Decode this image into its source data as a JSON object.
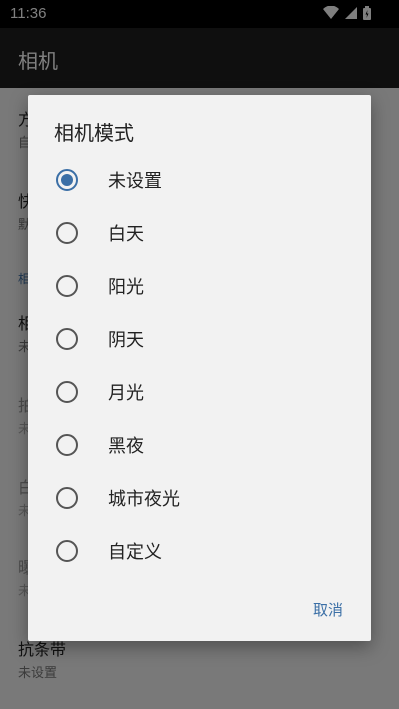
{
  "status_bar": {
    "time": "11:36"
  },
  "app_bar": {
    "title": "相机"
  },
  "background_settings": {
    "rows": [
      {
        "title": "方",
        "summary": "自"
      },
      {
        "title": "快",
        "summary": "默"
      },
      {
        "section": "相"
      },
      {
        "title": "相",
        "summary": "未"
      },
      {
        "title": "拍",
        "summary": "未"
      },
      {
        "title": "白",
        "summary": "未"
      },
      {
        "title": "曝",
        "summary": "未"
      },
      {
        "title": "抗条带",
        "summary": "未设置"
      }
    ]
  },
  "dialog": {
    "title": "相机模式",
    "options": [
      {
        "label": "未设置",
        "selected": true
      },
      {
        "label": "白天",
        "selected": false
      },
      {
        "label": "阳光",
        "selected": false
      },
      {
        "label": "阴天",
        "selected": false
      },
      {
        "label": "月光",
        "selected": false
      },
      {
        "label": "黑夜",
        "selected": false
      },
      {
        "label": "城市夜光",
        "selected": false
      },
      {
        "label": "自定义",
        "selected": false
      }
    ],
    "cancel_label": "取消"
  },
  "colors": {
    "accent": "#3b6fa6",
    "dialog_bg": "#f2f2f2"
  }
}
